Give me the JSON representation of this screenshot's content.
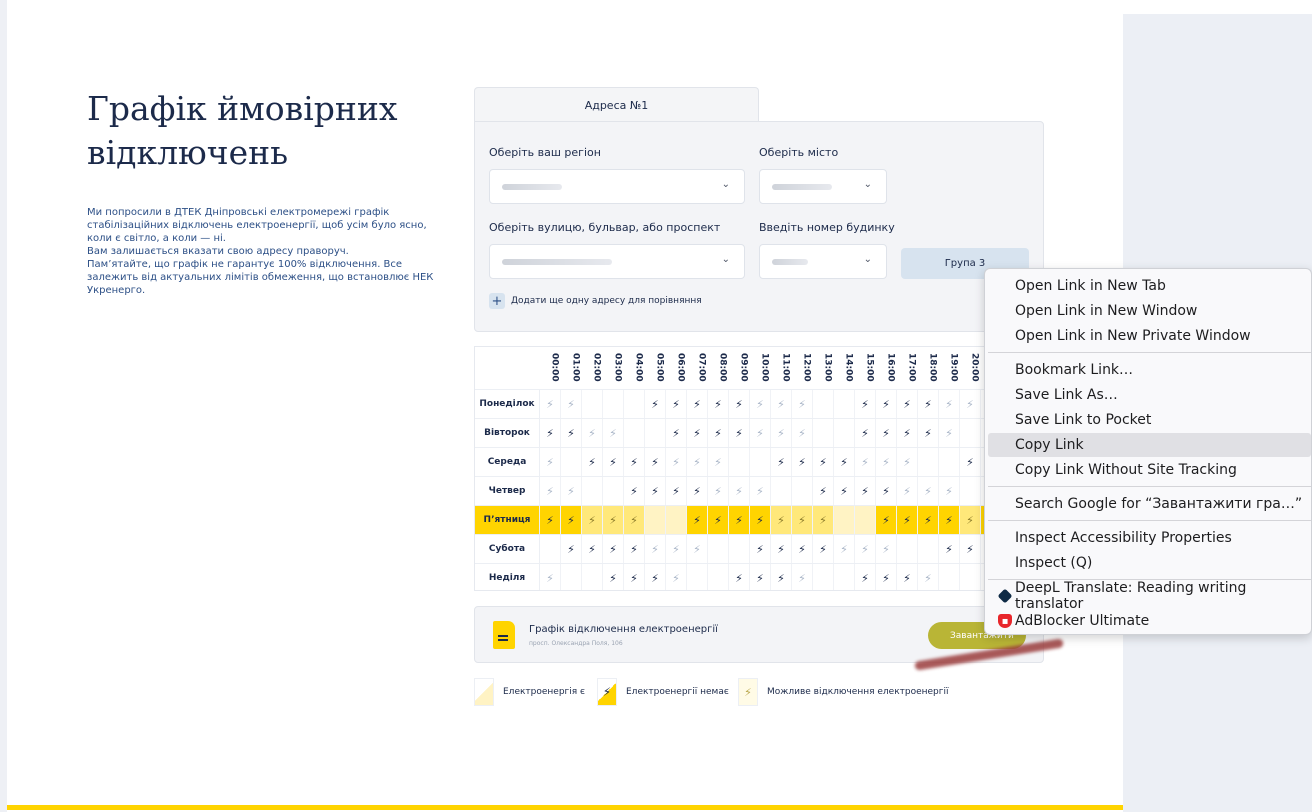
{
  "page": {
    "title": "Графік ймовірних відключень",
    "description": [
      "Ми попросили в ДТЕК Дніпровські електромережі графік стабілізаційних відключень електроенергії, щоб усім було ясно, коли є світло, а коли — ні.",
      "Вам залишається вказати свою адресу праворуч.",
      "Пам’ятайте, що графік не гарантує 100% відключення. Все залежить від актуальних лімітів обмеження, що встановлює НЕК Укренерго."
    ]
  },
  "form": {
    "tab_label": "Адреса №1",
    "region_label": "Оберіть ваш регіон",
    "city_label": "Оберіть місто",
    "street_label": "Оберіть вулицю, бульвар, або проспект",
    "house_label": "Введіть номер будинку",
    "group_button": "Група 3",
    "add_address": "Додати ще одну адресу для порівняння"
  },
  "schedule": {
    "hours": [
      "00:00",
      "01:00",
      "02:00",
      "03:00",
      "04:00",
      "05:00",
      "06:00",
      "07:00",
      "08:00",
      "09:00",
      "10:00",
      "11:00",
      "12:00",
      "13:00",
      "14:00",
      "15:00",
      "16:00",
      "17:00",
      "18:00",
      "19:00",
      "20:00"
    ],
    "days": [
      {
        "name": "Понеділок",
        "cells": "mm   NNNNNmmm  NNNNmmm"
      },
      {
        "name": "Вівторок",
        "cells": "NNmm  NNNNmmm  NNNNm"
      },
      {
        "name": "Середа",
        "cells": "m NNNNmmm  NNNNmmm  NN"
      },
      {
        "name": "Четвер",
        "cells": "mm  NNNNmmm  NNNNmmm"
      },
      {
        "name": "П’ятниця",
        "cells": "NNmmm  NNNNmmm  NNNNm",
        "highlight": true
      },
      {
        "name": "Субота",
        "cells": " NNNNmmm  NNNNmmm  NN"
      },
      {
        "name": "Неділя",
        "cells": "m  NNNm  NNNm  NNNm"
      }
    ]
  },
  "download": {
    "title": "Графік відключення електроенергії",
    "subtitle": "просп. Олександра Поля, 106",
    "button": "Завантажити"
  },
  "legend": [
    {
      "label": "Електроенергія є",
      "type": "yes"
    },
    {
      "label": "Електроенергії немає",
      "type": "no"
    },
    {
      "label": "Можливе відключення електроенергії",
      "type": "maybe"
    }
  ],
  "context_menu": {
    "items": [
      "Open Link in New Tab",
      "Open Link in New Window",
      "Open Link in New Private Window",
      "Bookmark Link…",
      "Save Link As…",
      "Save Link to Pocket",
      "Copy Link",
      "Copy Link Without Site Tracking",
      "Search Google for “Завантажити гра…”",
      "Inspect Accessibility Properties",
      "Inspect (Q)",
      "DeepL Translate: Reading writing translator",
      "AdBlocker Ultimate"
    ],
    "active_item": "Copy Link",
    "icons": {
      "deepl": "deepl-icon",
      "adblocker": "adblocker-icon"
    }
  },
  "colors": {
    "accent_yellow": "#ffd400",
    "text_navy": "#1c2a4a",
    "menu_highlight": "#e0e0e4"
  }
}
